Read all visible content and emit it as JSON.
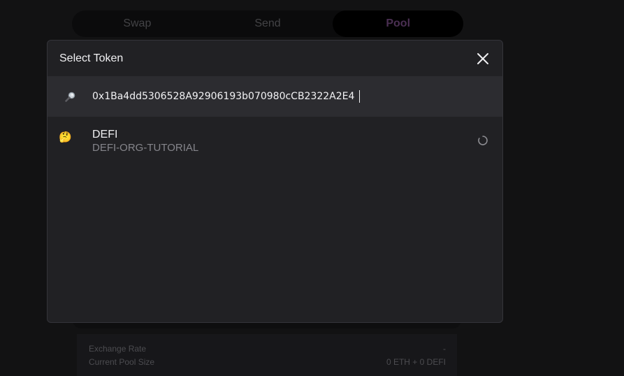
{
  "tabs": [
    {
      "label": "Swap",
      "active": false
    },
    {
      "label": "Send",
      "active": false
    },
    {
      "label": "Pool",
      "active": true
    }
  ],
  "details": {
    "exchange_rate_label": "Exchange Rate",
    "exchange_rate_value": "-",
    "pool_size_label": "Current Pool Size",
    "pool_size_value": "0 ETH + 0 DEFI"
  },
  "modal": {
    "title": "Select Token",
    "close_icon": "close-icon",
    "search": {
      "icon": "magnifier-icon",
      "value": "0x1Ba4dd5306528A92906193b070980cCB2322A2E4",
      "placeholder": ""
    },
    "tokens": [
      {
        "emoji": "🤔",
        "symbol": "DEFI",
        "name": "DEFI-ORG-TUTORIAL",
        "status_icon": "loading-spinner-icon"
      }
    ]
  },
  "colors": {
    "modal_bg": "#212124",
    "search_bg": "#2c2c30",
    "active_tab_text": "#4a2f52"
  }
}
